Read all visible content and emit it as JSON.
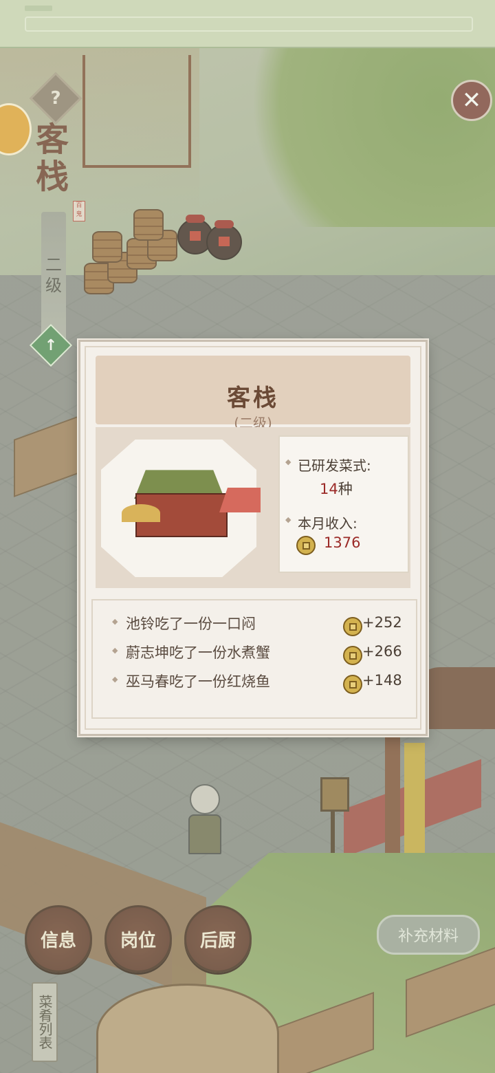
{
  "header": {
    "title": "客栈",
    "level": "二级",
    "seal_text": "百鬼"
  },
  "icons": {
    "help": "question-icon",
    "close": "close-icon",
    "upgrade": "upgrade-icon",
    "coin": "coin-icon"
  },
  "help_glyph": "?",
  "close_glyph": "✕",
  "popup": {
    "title": "客栈",
    "subtitle": "(二级)",
    "stats": {
      "dishes_label": "已研发菜式:",
      "dishes_value": "14",
      "dishes_unit": "种",
      "income_label": "本月收入:",
      "income_value": "1376"
    },
    "log": [
      {
        "text": "池铃吃了一份一口闷",
        "amount": "+252"
      },
      {
        "text": "蔚志坤吃了一份水煮蟹",
        "amount": "+266"
      },
      {
        "text": "巫马春吃了一份红烧鱼",
        "amount": "+148"
      }
    ]
  },
  "buttons": {
    "info": "信息",
    "posts": "岗位",
    "kitchen": "后厨",
    "supply": "补充材料",
    "menu_list": "菜肴列表"
  },
  "colors": {
    "accent_red": "#9b2a27",
    "button_brown": "#5a2f22",
    "upgrade_green": "#4e8b57"
  }
}
